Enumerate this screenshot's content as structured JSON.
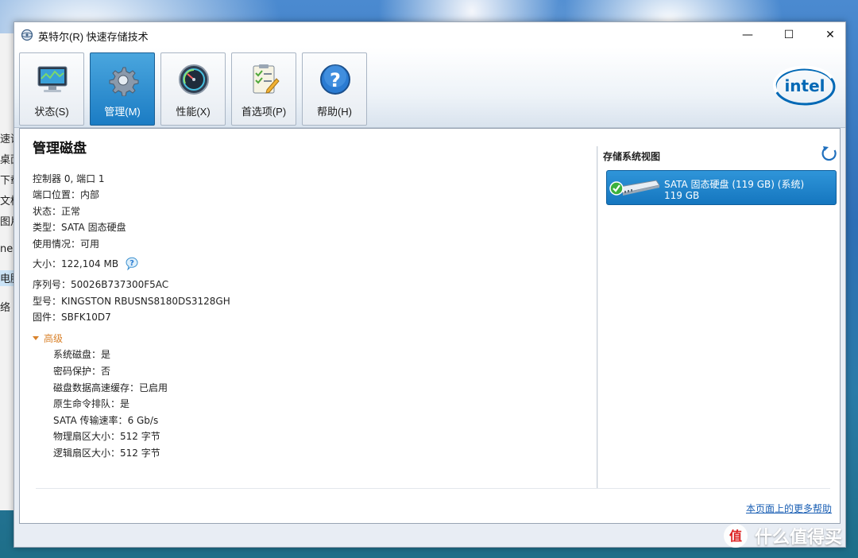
{
  "window": {
    "title": "英特尔(R) 快速存储技术",
    "controls": {
      "minimize": "—",
      "maximize": "☐",
      "close": "✕"
    }
  },
  "background_sidebar": {
    "items": [
      "速读",
      "桌面",
      "下载",
      "文档",
      "图片",
      "neD",
      "电脑",
      "络"
    ],
    "selected_index": 6
  },
  "toolbar": {
    "tabs": [
      {
        "label": "状态(S)",
        "icon": "monitor-status-icon",
        "active": false
      },
      {
        "label": "管理(M)",
        "icon": "gear-icon",
        "active": true
      },
      {
        "label": "性能(X)",
        "icon": "gauge-icon",
        "active": false
      },
      {
        "label": "首选项(P)",
        "icon": "checklist-icon",
        "active": false
      },
      {
        "label": "帮助(H)",
        "icon": "help-question-icon",
        "active": false
      }
    ],
    "brand_logo": "intel"
  },
  "manage_disk": {
    "title": "管理磁盘",
    "controller_port": "控制器 0, 端口 1",
    "properties": [
      {
        "key": "端口位置",
        "value": "内部"
      },
      {
        "key": "状态",
        "value": "正常"
      },
      {
        "key": "类型",
        "value": "SATA 固态硬盘"
      },
      {
        "key": "使用情况",
        "value": "可用"
      },
      {
        "key": "大小",
        "value": "122,104 MB"
      },
      {
        "key": "序列号",
        "value": "50026B737300F5AC"
      },
      {
        "key": "型号",
        "value": "KINGSTON RBUSNS8180DS3128GH"
      },
      {
        "key": "固件",
        "value": "SBFK10D7"
      }
    ],
    "advanced_label": "高级",
    "advanced": [
      {
        "key": "系统磁盘",
        "value": "是"
      },
      {
        "key": "密码保护",
        "value": "否"
      },
      {
        "key": "磁盘数据高速缓存",
        "value": "已启用"
      },
      {
        "key": "原生命令排队",
        "value": "是"
      },
      {
        "key": "SATA 传输速率",
        "value": "6 Gb/s"
      },
      {
        "key": "物理扇区大小",
        "value": "512 字节"
      },
      {
        "key": "逻辑扇区大小",
        "value": "512 字节"
      }
    ]
  },
  "storage_view": {
    "title": "存储系统视图",
    "disk": {
      "name": "SATA 固态硬盘 (119 GB) (系统)",
      "size": "119 GB",
      "status": "ok"
    }
  },
  "footer": {
    "help_link": "本页面上的更多帮助"
  },
  "watermark": {
    "text": "什么值得买",
    "logo": "值"
  },
  "colors": {
    "active_tab": "#1b7cc4",
    "disk_card": "#1576bf",
    "advanced_accent": "#d9822b",
    "link": "#1a5fb4",
    "intel_blue": "#0068b5"
  }
}
